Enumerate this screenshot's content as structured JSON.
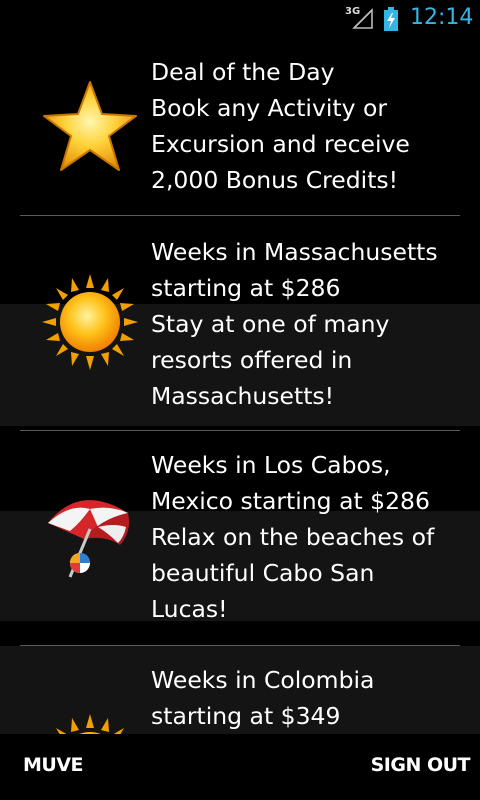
{
  "status_bar": {
    "network": "3G",
    "time": "12:14",
    "clock_color": "#33b5e5"
  },
  "deals": [
    {
      "icon": "star-icon",
      "text": "Deal of the Day\nBook any Activity or\nExcursion and receive\n2,000 Bonus Credits!"
    },
    {
      "icon": "sun-icon",
      "text": "Weeks in Massachusetts\nstarting at $286\nStay at one of many\nresorts offered in\nMassachusetts!"
    },
    {
      "icon": "beach-umbrella-icon",
      "text": "Weeks in Los Cabos,\nMexico starting at $286\nRelax on the beaches of\nbeautiful Cabo San\nLucas!"
    },
    {
      "icon": "sun-icon",
      "text": "Weeks in Colombia\nstarting at $349"
    }
  ],
  "bottom_bar": {
    "left_label": "MUVE",
    "right_label": "SIGN OUT"
  }
}
